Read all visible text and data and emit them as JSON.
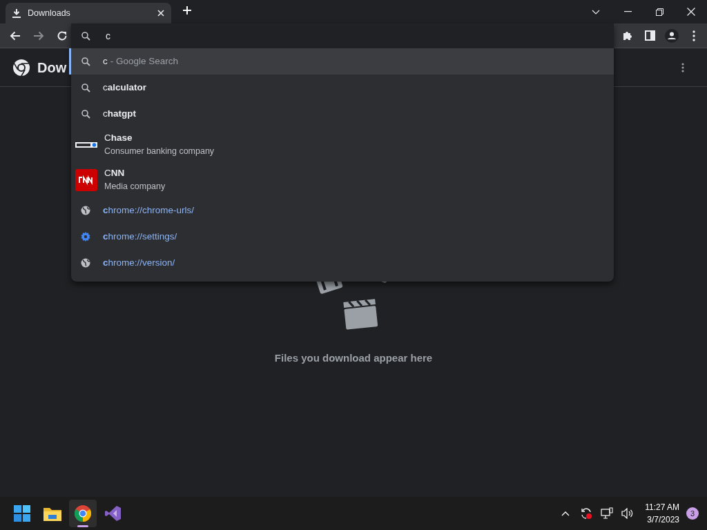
{
  "tabs": [
    {
      "title": "Downloads",
      "selected": true
    }
  ],
  "omnibox": {
    "value": "c"
  },
  "page": {
    "title": "Dow",
    "empty_message": "Files you download appear here"
  },
  "suggestions": [
    {
      "kind": "search",
      "text": "c",
      "suffix": "- Google Search",
      "selected": true
    },
    {
      "kind": "search",
      "text": "c**alculator**",
      "selected": false
    },
    {
      "kind": "search",
      "text": "c**hatgpt**",
      "selected": false
    },
    {
      "kind": "bank",
      "text": "C**hase**",
      "subtitle": "Consumer banking company",
      "selected": false
    },
    {
      "kind": "news",
      "text": "C**NN**",
      "subtitle": "Media company",
      "selected": false
    },
    {
      "kind": "page",
      "text": "**c**hrome://chrome-urls/",
      "selected": false
    },
    {
      "kind": "settings",
      "text": "**c**hrome://settings/",
      "selected": false
    },
    {
      "kind": "page",
      "text": "**c**hrome://version/",
      "selected": false
    }
  ],
  "taskbar": {
    "apps": [
      {
        "kind": "start",
        "active": false
      },
      {
        "kind": "folder",
        "active": false
      },
      {
        "kind": "browser",
        "active": true
      },
      {
        "kind": "studio",
        "active": false
      }
    ],
    "time": "11:27 AM",
    "date": "3/7/2023",
    "notifications": "3"
  }
}
